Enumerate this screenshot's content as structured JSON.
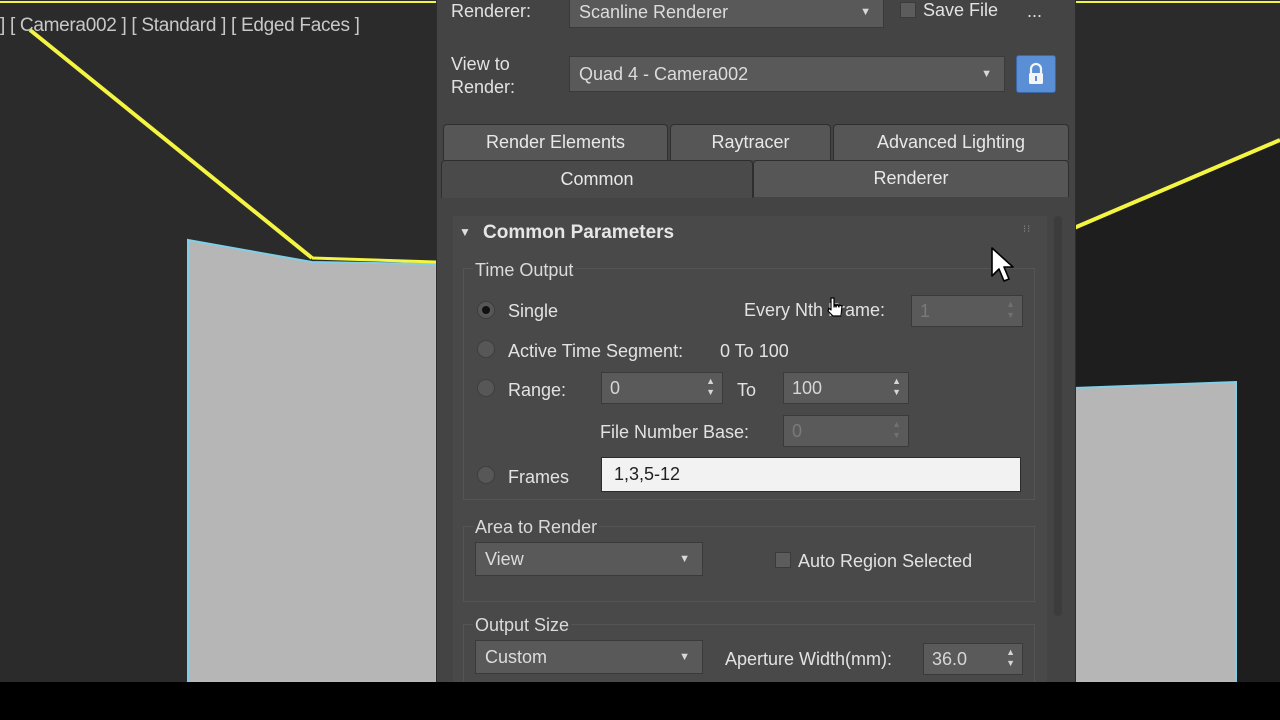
{
  "viewport": {
    "label": "] [ Camera002 ] [ Standard ] [ Edged Faces ]"
  },
  "dialog": {
    "renderer_label": "Renderer:",
    "renderer_value": "Scanline Renderer",
    "save_file_label": "Save File",
    "more_label": "...",
    "view_to_render_label_1": "View to",
    "view_to_render_label_2": "Render:",
    "view_to_render_value": "Quad 4 - Camera002",
    "tabs_row1": [
      "Render Elements",
      "Raytracer",
      "Advanced Lighting"
    ],
    "tabs_row2": [
      "Common",
      "Renderer"
    ],
    "rollout_title": "Common Parameters",
    "time_output": {
      "title": "Time Output",
      "single_label": "Single",
      "every_nth_label": "Every Nth Frame:",
      "every_nth_value": "1",
      "active_segment_label": "Active Time Segment:",
      "active_segment_value": "0 To 100",
      "range_label": "Range:",
      "range_from": "0",
      "range_to_label": "To",
      "range_to": "100",
      "file_number_base_label": "File Number Base:",
      "file_number_base_value": "0",
      "frames_label": "Frames",
      "frames_value": "1,3,5-12"
    },
    "area_to_render": {
      "title": "Area to Render",
      "value": "View",
      "auto_region_label": "Auto Region Selected"
    },
    "output_size": {
      "title": "Output Size",
      "value": "Custom",
      "aperture_label": "Aperture Width(mm):",
      "aperture_value": "36.0"
    }
  },
  "colors": {
    "accent_lock": "#5a8fd6",
    "viewport_yellow": "#f4f442",
    "viewport_cyan": "#7fd0e6"
  }
}
